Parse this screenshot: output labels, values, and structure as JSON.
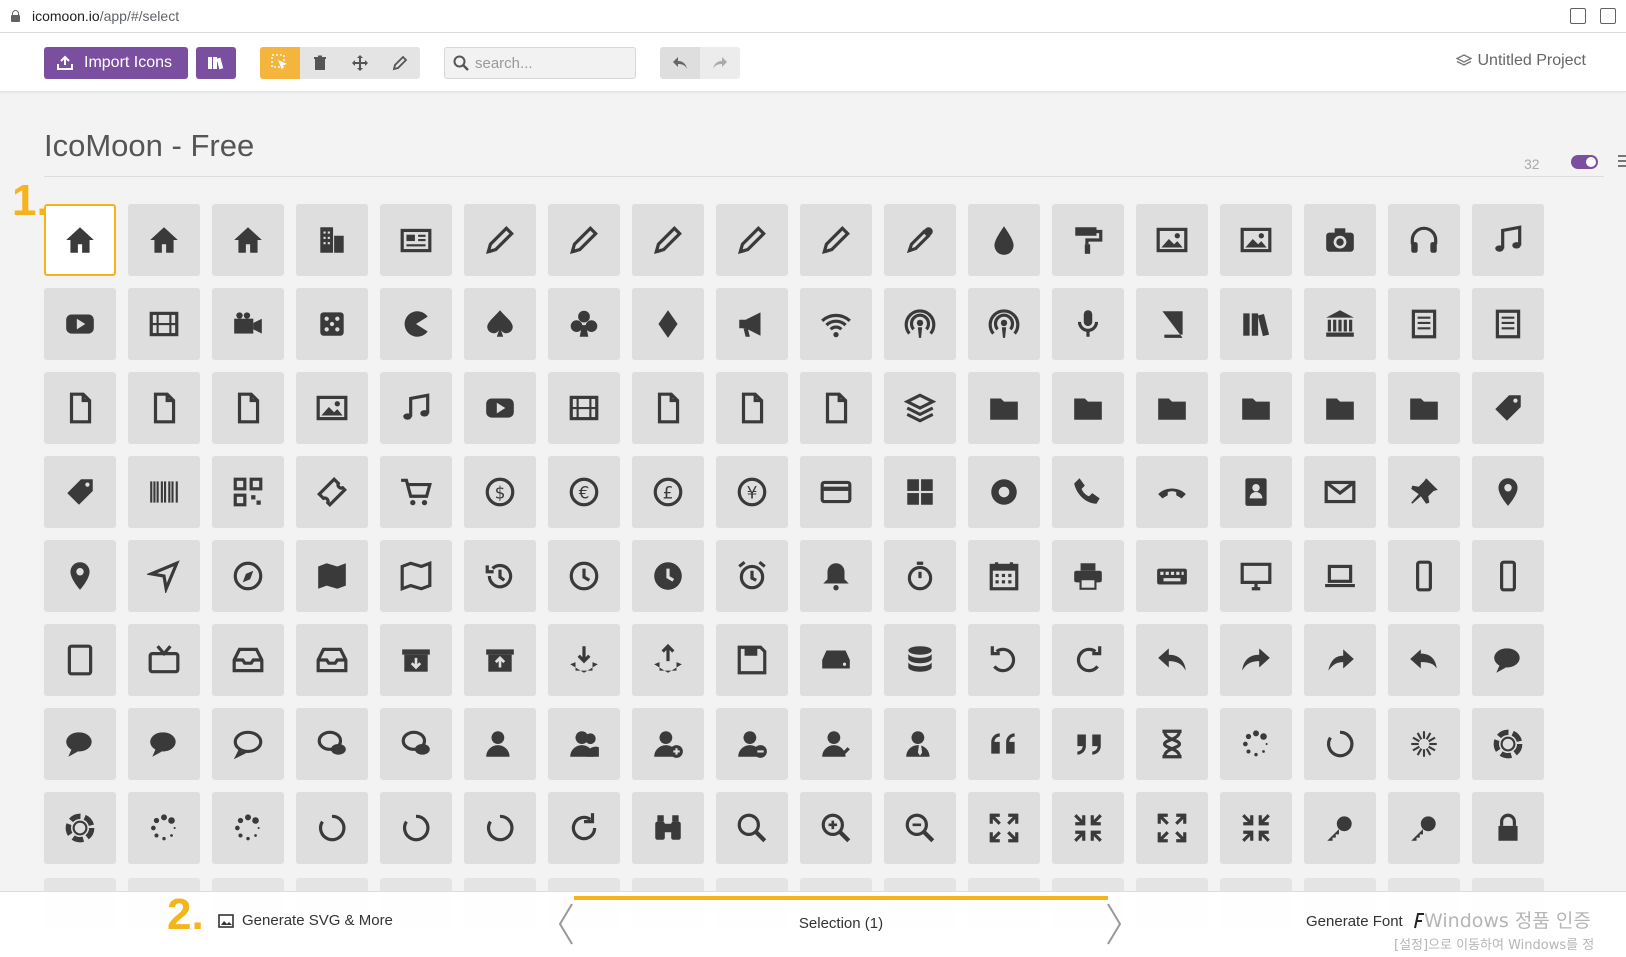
{
  "browser": {
    "url_host": "icomoon.io",
    "url_path": "/app/#/select"
  },
  "toolbar": {
    "import_label": "Import Icons",
    "search_placeholder": "search...",
    "project_label": "Untitled Project"
  },
  "set": {
    "title": "IcoMoon - Free",
    "grid_size": "32"
  },
  "steps": {
    "step1": "1.",
    "step2": "2."
  },
  "icons": [
    "home",
    "home2",
    "home3",
    "office",
    "newspaper",
    "pencil",
    "pencil2",
    "quill",
    "pen",
    "blog",
    "eyedropper",
    "droplet",
    "paint-format",
    "image",
    "images",
    "camera",
    "headphones",
    "music",
    "play",
    "film",
    "video-camera",
    "dice",
    "pacman",
    "spades",
    "clubs",
    "diamonds",
    "bullhorn",
    "connection",
    "podcast",
    "feed",
    "mic",
    "book",
    "books",
    "library",
    "file-text",
    "profile",
    "file-empty",
    "files-empty",
    "file-text2",
    "file-picture",
    "file-music",
    "file-play",
    "file-video",
    "file-zip",
    "copy",
    "paste",
    "stack",
    "folder",
    "folder-open",
    "folder-plus",
    "folder-minus",
    "folder-download",
    "folder-upload",
    "price-tag",
    "price-tags",
    "barcode",
    "qrcode",
    "ticket",
    "cart",
    "coin-dollar",
    "coin-euro",
    "coin-pound",
    "coin-yen",
    "credit-card",
    "calculator",
    "lifebuoy",
    "phone",
    "phone-hang-up",
    "address-book",
    "envelop",
    "pushpin",
    "location",
    "location2",
    "compass",
    "compass2",
    "map",
    "map2",
    "history",
    "clock",
    "clock2",
    "alarm",
    "bell",
    "stopwatch",
    "calendar",
    "printer",
    "keyboard",
    "display",
    "laptop",
    "mobile",
    "mobile2",
    "tablet",
    "tv",
    "drawer",
    "drawer2",
    "box-add",
    "box-remove",
    "download",
    "upload",
    "floppy-disk",
    "drive",
    "database",
    "undo",
    "redo",
    "undo2",
    "redo2",
    "forward",
    "reply",
    "bubble",
    "bubbles",
    "bubbles2",
    "bubble2",
    "bubbles3",
    "bubbles4",
    "user",
    "users",
    "user-plus",
    "user-minus",
    "user-check",
    "user-tie",
    "quotes-left",
    "quotes-right",
    "hour-glass",
    "spinner",
    "spinner2",
    "spinner3",
    "spinner4",
    "spinner5",
    "spinner6",
    "spinner7",
    "spinner8",
    "spinner9",
    "spinner10",
    "spinner11",
    "binoculars",
    "search",
    "zoom-in",
    "zoom-out",
    "enlarge",
    "shrink",
    "enlarge2",
    "shrink2",
    "key",
    "key2",
    "lock"
  ],
  "bottombar": {
    "generate_svg_label": "Generate SVG & More",
    "selection_label": "Selection (1)",
    "generate_font_label": "Generate Font"
  },
  "watermark": {
    "line1": "Windows 정품 인증",
    "line2": "[설정]으로 이동하여 Windows를 정"
  },
  "colors": {
    "accent_purple": "#7b4fa0",
    "highlight_orange": "#f5b31c",
    "tile_gray": "#dedede"
  }
}
